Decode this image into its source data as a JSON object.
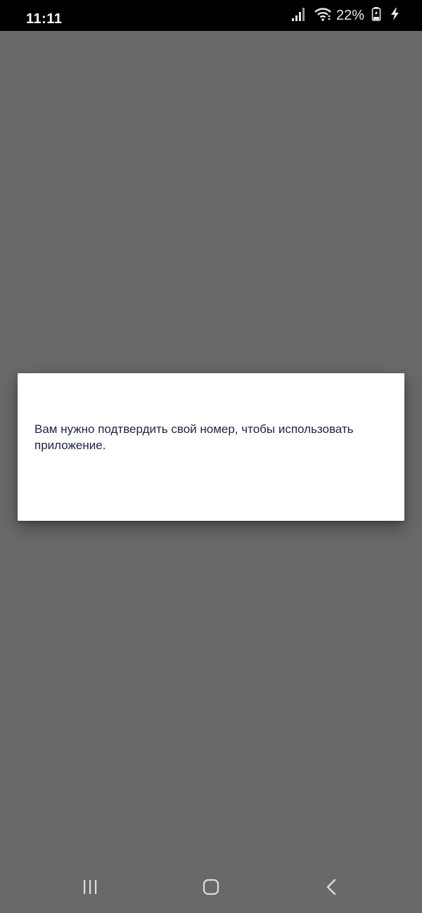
{
  "status_bar": {
    "time": "11:11",
    "battery_percent": "22%",
    "icons": [
      "signal-icon",
      "wifi-icon",
      "battery-icon",
      "charging-bolt-icon"
    ]
  },
  "dialog": {
    "message": "Вам нужно подтвердить свой номер, чтобы использовать приложение."
  },
  "nav_bar": {
    "buttons": [
      "recent-apps",
      "home",
      "back"
    ]
  },
  "colors": {
    "scrim": "#696969",
    "status_bar_bg": "#000000",
    "dialog_bg": "#ffffff",
    "message_text": "#1b2540"
  }
}
